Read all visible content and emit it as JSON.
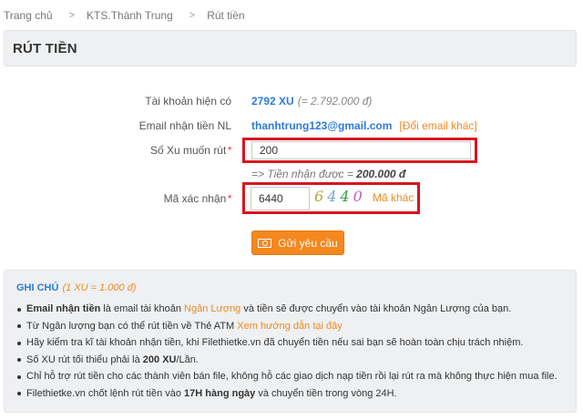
{
  "breadcrumb": [
    "Trang chủ",
    "KTS.Thành Trung",
    "Rút tiền"
  ],
  "breadcrumb_separator": ">",
  "page_title": "RÚT TIỀN",
  "form": {
    "account_label": "Tài khoản hiện có",
    "account_amount": "2792 XU",
    "account_equiv": "(= 2.792.000 đ)",
    "email_label": "Email nhận tiền NL",
    "email_value": "thanhtrung123@gmail.com",
    "email_change": "[Đổi email khác]",
    "xu_label": "Số Xu muốn rút",
    "xu_value": "200",
    "required_mark": "*",
    "receive_prefix": "=> Tiền nhận được = ",
    "receive_amount": "200.000 đ",
    "code_label": "Mã xác nhận",
    "code_value": "6440",
    "captcha_chars": [
      "6",
      "4",
      "4",
      "0"
    ],
    "other_code": "Mã khác",
    "submit_label": "Gửi yêu cầu",
    "submit_icon": "money-icon"
  },
  "notes": {
    "title": "GHI CHÚ",
    "rate": "(1 XU = 1.000 đ)",
    "items": [
      {
        "bold": "Email nhận tiền",
        "t1": " là email tài khoản ",
        "link": "Ngân Lượng",
        "t2": " và tiền sẽ được chuyển vào tài khoản Ngân Lượng của bạn."
      },
      {
        "t1": "Từ Ngân lượng bạn có thể rút tiền về Thẻ ATM ",
        "link": "Xem hướng dẫn tại đây"
      },
      {
        "t1": "Hãy kiểm tra kĩ tài khoản nhận tiền, khi Filethietke.vn đã chuyển tiền nếu sai bạn sẽ hoàn toàn chịu trách nhiệm."
      },
      {
        "t1": "Số XU rút tối thiểu phải là ",
        "bold": "200 XU",
        "t2": "/Lần."
      },
      {
        "t1": "Chỉ hỗ trợ rút tiền cho các thành viên bán file, không hỗ các giao dịch nạp tiền rồi lại rút ra mà không thực hiện mua file."
      },
      {
        "t1": "Filethietke.vn chốt lệnh rút tiền vào ",
        "bold": "17H hàng ngày",
        "t2": " và chuyển tiền trong vòng 24H."
      }
    ]
  },
  "colors": {
    "accent_blue": "#2c7bd8",
    "accent_orange": "#f5871f",
    "highlight_red": "#d9141f"
  }
}
